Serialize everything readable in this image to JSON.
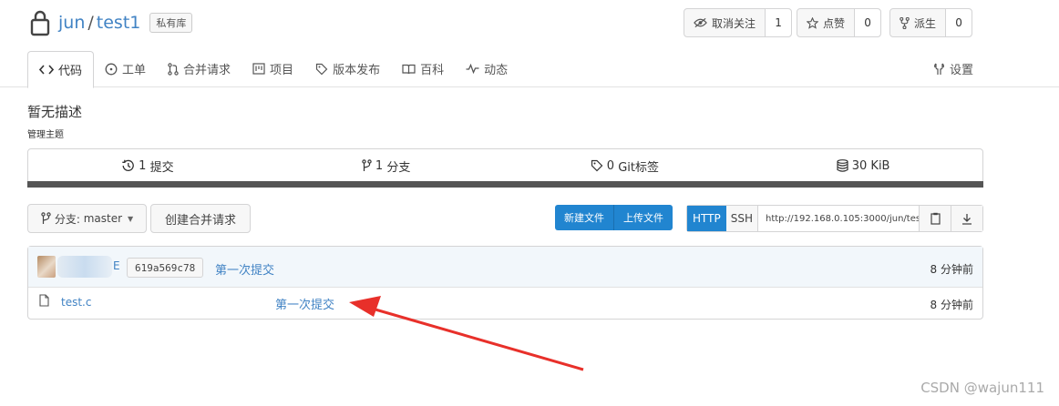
{
  "repo": {
    "owner": "jun",
    "separator": "/",
    "name": "test1",
    "visibility": "私有库"
  },
  "actions": [
    {
      "label": "取消关注",
      "count": "1",
      "icon": "eye-slash-icon"
    },
    {
      "label": "点赞",
      "count": "0",
      "icon": "star-icon"
    },
    {
      "label": "派生",
      "count": "0",
      "icon": "fork-icon"
    }
  ],
  "tabs": [
    {
      "label": "代码",
      "icon": "code-icon",
      "active": true
    },
    {
      "label": "工单",
      "icon": "issue-icon"
    },
    {
      "label": "合并请求",
      "icon": "pull-request-icon"
    },
    {
      "label": "项目",
      "icon": "project-icon"
    },
    {
      "label": "版本发布",
      "icon": "tag-icon"
    },
    {
      "label": "百科",
      "icon": "book-icon"
    },
    {
      "label": "动态",
      "icon": "pulse-icon"
    }
  ],
  "settings_label": "设置",
  "description": "暂无描述",
  "topics_label": "管理主题",
  "stats": [
    {
      "value": "1",
      "label": "提交",
      "icon": "history-icon"
    },
    {
      "value": "1",
      "label": "分支",
      "icon": "branch-icon"
    },
    {
      "value": "0",
      "label": "Git标签",
      "icon": "tag-icon"
    },
    {
      "value": "30 KiB",
      "label": "",
      "icon": "database-icon"
    }
  ],
  "branch": {
    "prefix": "分支:",
    "name": "master"
  },
  "new_pr_label": "创建合并请求",
  "new_file_label": "新建文件",
  "upload_file_label": "上传文件",
  "clone": {
    "http": "HTTP",
    "ssh": "SSH",
    "url": "http://192.168.0.105:3000/jun/tes"
  },
  "latest_commit": {
    "author": "E",
    "sha": "619a569c78",
    "message": "第一次提交",
    "time": "8 分钟前"
  },
  "files": [
    {
      "name": "test.c",
      "message": "第一次提交",
      "time": "8 分钟前"
    }
  ],
  "watermark": "CSDN @wajun111",
  "colors": {
    "link": "#4183c4",
    "primary": "#2185d0",
    "annotation": "#e8302a"
  }
}
